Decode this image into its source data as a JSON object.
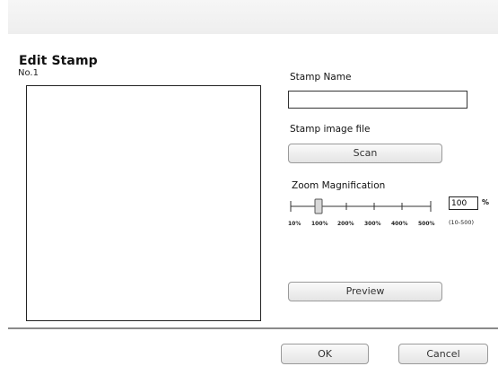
{
  "dialog": {
    "title": "Edit Stamp",
    "stamp_number": "No.1"
  },
  "stamp_name": {
    "label": "Stamp Name",
    "value": ""
  },
  "stamp_image": {
    "label": "Stamp image file",
    "scan_label": "Scan"
  },
  "zoom": {
    "label": "Zoom Magnification",
    "value": "100",
    "unit": "%",
    "range_hint": "(10-500)",
    "ticks": [
      "10%",
      "100%",
      "200%",
      "300%",
      "400%",
      "500%"
    ]
  },
  "preview_label": "Preview",
  "footer": {
    "ok_label": "OK",
    "cancel_label": "Cancel"
  }
}
